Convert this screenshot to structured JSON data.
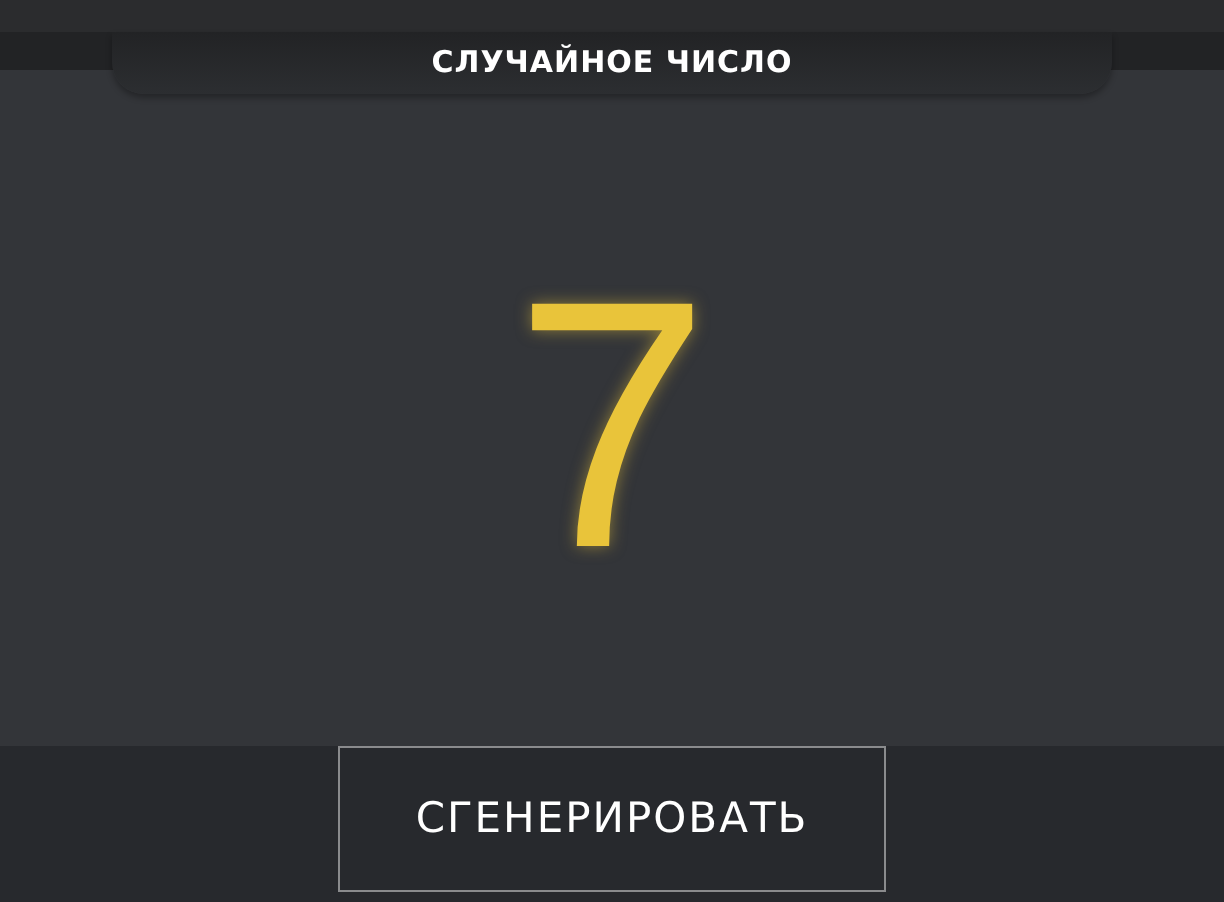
{
  "header": {
    "title": "СЛУЧАЙНОЕ ЧИСЛО"
  },
  "result": {
    "value": "7"
  },
  "buttons": [
    {
      "label": "СГЕНЕРИРОВАТЬ"
    }
  ]
}
